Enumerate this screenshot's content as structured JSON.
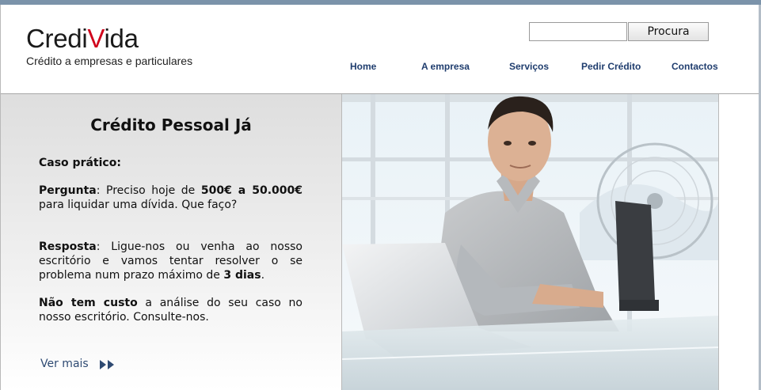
{
  "header": {
    "logo_prefix": "Credi",
    "logo_accent": "V",
    "logo_suffix": "ida",
    "tagline": "Crédito a empresas e particulares",
    "brand_color": "#d0021b"
  },
  "search": {
    "value": "",
    "button_label": "Procura"
  },
  "nav": {
    "items": [
      {
        "label": "Home"
      },
      {
        "label": "A empresa"
      },
      {
        "label": "Serviços"
      },
      {
        "label": "Pedir Crédito"
      },
      {
        "label": "Contactos"
      }
    ],
    "color": "#1f3d6e"
  },
  "promo": {
    "title": "Crédito Pessoal Já",
    "case_label": "Caso prático:",
    "question_label": "Pergunta",
    "question_text_1": ": Preciso hoje de ",
    "question_amount": "500€ a 50.000€",
    "question_text_2": " para liquidar uma dívida. Que faço?",
    "answer_label": "Resposta",
    "answer_text_1": ": Ligue-nos ou venha ao nosso escritório e vamos tentar resolver o se problema num prazo máximo de ",
    "answer_deadline": "3 dias",
    "answer_text_2": ".",
    "no_cost_label": "Não tem custo",
    "no_cost_text": " a análise do seu caso no nosso escritório. Consulte-nos.",
    "more_label": "Ver mais",
    "more_icon": "double-chevron-right-icon"
  },
  "hero": {
    "image": "photo-man-with-laptop"
  }
}
